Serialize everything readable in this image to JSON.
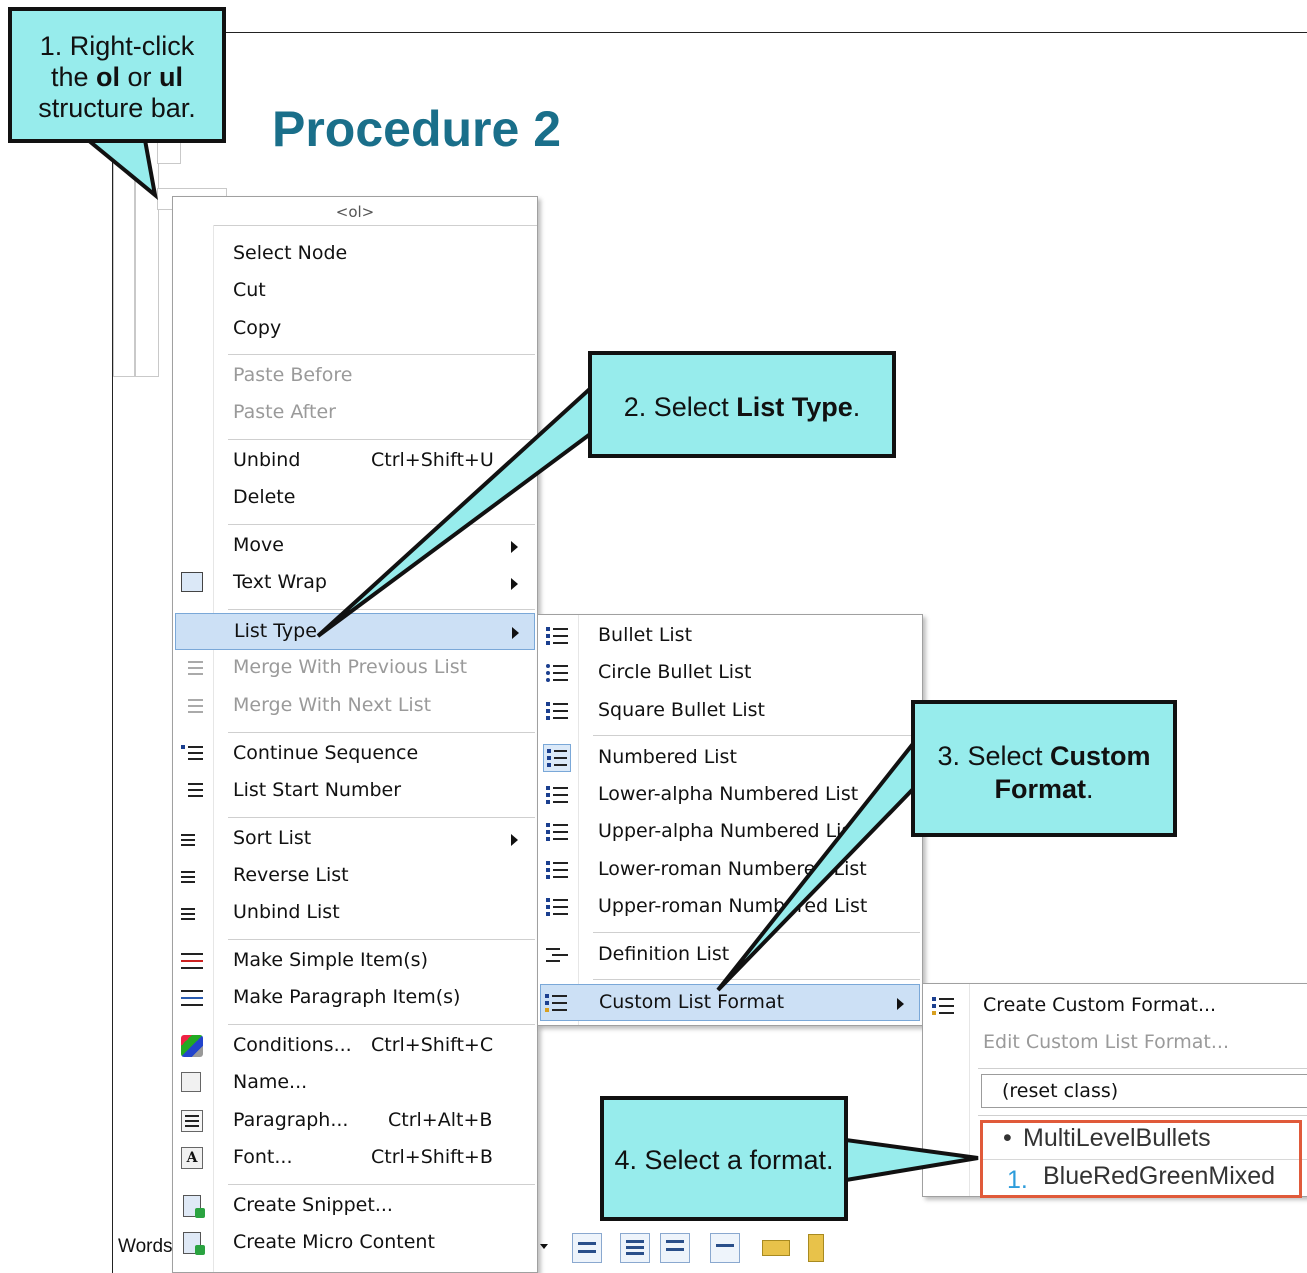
{
  "document": {
    "title": "Procedure 2",
    "status_words": "Words"
  },
  "callouts": {
    "c1": {
      "line1": "1. Right-click",
      "line2_a": "the ",
      "line2_b": "ol",
      "line2_c": " or ",
      "line2_d": "ul",
      "line3": "structure bar."
    },
    "c2": {
      "pre": "2. Select ",
      "bold": "List Type",
      "post": "."
    },
    "c3": {
      "pre": "3. Select ",
      "bold1": "Custom",
      "bold2": "Format",
      "post": "."
    },
    "c4": {
      "text": "4. Select a format."
    }
  },
  "context_menu": {
    "header": "<ol>",
    "items": [
      {
        "label": "Select Node"
      },
      {
        "label": "Cut"
      },
      {
        "label": "Copy"
      },
      {
        "label": "Paste Before",
        "disabled": true
      },
      {
        "label": "Paste After",
        "disabled": true
      },
      {
        "label": "Unbind",
        "shortcut": "Ctrl+Shift+U"
      },
      {
        "label": "Delete"
      },
      {
        "label": "Move"
      },
      {
        "label": "Text Wrap"
      },
      {
        "label": "List Type"
      },
      {
        "label": "Merge With Previous List",
        "disabled": true
      },
      {
        "label": "Merge With Next List",
        "disabled": true
      },
      {
        "label": "Continue Sequence"
      },
      {
        "label": "List Start Number"
      },
      {
        "label": "Sort List"
      },
      {
        "label": "Reverse List"
      },
      {
        "label": "Unbind List"
      },
      {
        "label": "Make Simple Item(s)"
      },
      {
        "label": "Make Paragraph Item(s)"
      },
      {
        "label": "Conditions...",
        "shortcut": "Ctrl+Shift+C"
      },
      {
        "label": "Name..."
      },
      {
        "label": "Paragraph...",
        "shortcut": "Ctrl+Alt+B"
      },
      {
        "label": "Font...",
        "shortcut": "Ctrl+Shift+B"
      },
      {
        "label": "Create Snippet..."
      },
      {
        "label": "Create Micro Content"
      }
    ]
  },
  "list_type_menu": {
    "items": [
      {
        "label": "Bullet List"
      },
      {
        "label": "Circle Bullet List"
      },
      {
        "label": "Square Bullet List"
      },
      {
        "label": "Numbered List"
      },
      {
        "label": "Lower-alpha Numbered List"
      },
      {
        "label": "Upper-alpha Numbered List"
      },
      {
        "label": "Lower-roman Numbered List"
      },
      {
        "label": "Upper-roman Numbered List"
      },
      {
        "label": "Definition List"
      },
      {
        "label": "Custom List Format"
      }
    ]
  },
  "custom_format_menu": {
    "create": "Create Custom Format...",
    "edit": "Edit Custom List Format...",
    "reset": "(reset class)",
    "formats": [
      {
        "marker": "•",
        "label": "MultiLevelBullets"
      },
      {
        "marker": "1.",
        "label": "BlueRedGreenMixed"
      }
    ]
  },
  "colors": {
    "callout": "#97ecec",
    "title": "#1a6f8a",
    "highlight": "#cce0f5",
    "format_box": "#e05a3a"
  }
}
